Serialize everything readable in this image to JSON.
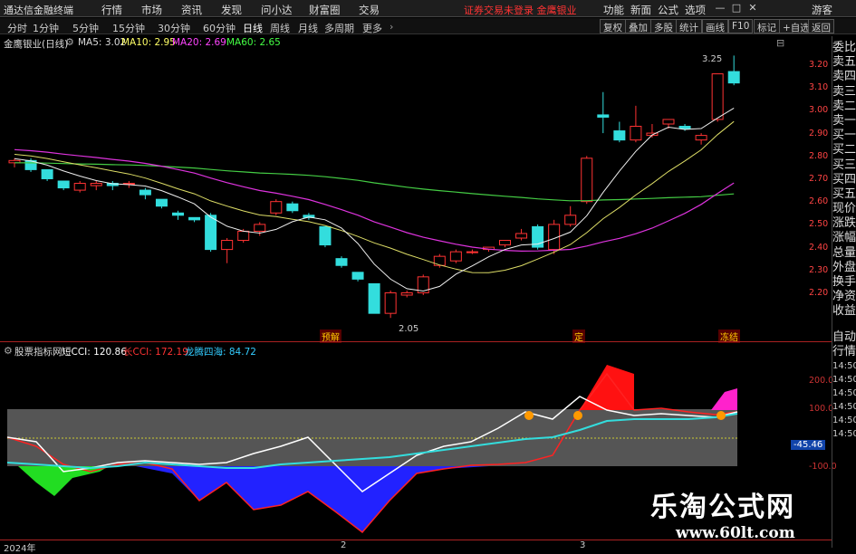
{
  "app": {
    "title": "通达信金融终端",
    "menus": [
      "行情",
      "市场",
      "资讯",
      "发现",
      "问小达",
      "财富圈",
      "交易"
    ],
    "notice": "证券交易未登录 金鹰银业",
    "top_right": [
      "功能",
      "新面",
      "公式",
      "选项"
    ],
    "window_btns": [
      "—",
      "□",
      "✕"
    ]
  },
  "toolbar": {
    "timeframes": [
      "分时",
      "1分钟",
      "5分钟",
      "15分钟",
      "30分钟",
      "60分钟",
      "日线",
      "周线",
      "月线",
      "多周期",
      "更多"
    ],
    "active": "日线",
    "right_buttons": [
      "复权",
      "叠加",
      "多股",
      "统计",
      "画线",
      "F10",
      "标记",
      "+自选",
      "返回"
    ],
    "guest": "游客"
  },
  "main_chart": {
    "title": "金鹰银业(日线)",
    "ma": [
      {
        "label": "MA5:",
        "value": "3.02",
        "color": "#dddddd"
      },
      {
        "label": "MA10:",
        "value": "2.95",
        "color": "#ffff66"
      },
      {
        "label": "MA20:",
        "value": "2.69",
        "color": "#ff44ff"
      },
      {
        "label": "MA60:",
        "value": "2.65",
        "color": "#44ff44"
      }
    ],
    "yaxis": [
      "3.20",
      "3.10",
      "3.00",
      "2.90",
      "2.80",
      "2.70",
      "2.60",
      "2.50",
      "2.40",
      "2.30",
      "2.20"
    ],
    "high_label": "3.25",
    "low_label": "2.05",
    "events": [
      "预解",
      "定",
      "冻结"
    ]
  },
  "sub_chart": {
    "title": "股票指标网",
    "indicators": [
      {
        "label": "短CCI: 120.86",
        "color": "#ffffff"
      },
      {
        "label": "长CCI: 172.19",
        "color": "#ff3333"
      },
      {
        "label": "龙腾四海: 84.72",
        "color": "#33ccff"
      }
    ],
    "yaxis": [
      "200.0",
      "100.0",
      "-100.0"
    ],
    "current": "-45.46"
  },
  "side_panel": [
    "委比",
    "卖五",
    "卖四",
    "卖三",
    "卖二",
    "卖一",
    "买一",
    "买二",
    "买三",
    "买四",
    "买五",
    "现价",
    "涨跌",
    "涨幅",
    "总量",
    "外盘",
    "换手",
    "净资",
    "收益",
    "自动",
    "行情"
  ],
  "side_times": [
    "14:50",
    "14:50",
    "14:50",
    "14:50",
    "14:50",
    "14:50"
  ],
  "dates": [
    "2024年",
    "2",
    "3"
  ],
  "watermark": {
    "line1": "乐淘公式网",
    "line2": "www.60lt.com"
  },
  "chart_data": {
    "type": "candlestick",
    "ohlc_note": "approximate daily candles",
    "candles": [
      [
        2.78,
        2.8,
        2.76,
        2.79
      ],
      [
        2.79,
        2.8,
        2.74,
        2.75
      ],
      [
        2.75,
        2.75,
        2.7,
        2.71
      ],
      [
        2.7,
        2.7,
        2.66,
        2.67
      ],
      [
        2.66,
        2.7,
        2.65,
        2.69
      ],
      [
        2.68,
        2.7,
        2.66,
        2.69
      ],
      [
        2.69,
        2.7,
        2.66,
        2.68
      ],
      [
        2.69,
        2.7,
        2.67,
        2.69
      ],
      [
        2.66,
        2.67,
        2.62,
        2.64
      ],
      [
        2.62,
        2.62,
        2.58,
        2.59
      ],
      [
        2.56,
        2.57,
        2.53,
        2.55
      ],
      [
        2.54,
        2.54,
        2.52,
        2.53
      ],
      [
        2.55,
        2.56,
        2.39,
        2.4
      ],
      [
        2.4,
        2.45,
        2.34,
        2.44
      ],
      [
        2.44,
        2.49,
        2.43,
        2.48
      ],
      [
        2.48,
        2.52,
        2.46,
        2.51
      ],
      [
        2.56,
        2.62,
        2.55,
        2.61
      ],
      [
        2.6,
        2.61,
        2.56,
        2.57
      ],
      [
        2.55,
        2.56,
        2.53,
        2.54
      ],
      [
        2.5,
        2.5,
        2.41,
        2.42
      ],
      [
        2.36,
        2.37,
        2.32,
        2.33
      ],
      [
        2.3,
        2.3,
        2.26,
        2.27
      ],
      [
        2.25,
        2.25,
        2.13,
        2.12
      ],
      [
        2.12,
        2.22,
        2.1,
        2.21
      ],
      [
        2.2,
        2.22,
        2.19,
        2.21
      ],
      [
        2.21,
        2.29,
        2.2,
        2.28
      ],
      [
        2.33,
        2.38,
        2.32,
        2.37
      ],
      [
        2.35,
        2.4,
        2.34,
        2.39
      ],
      [
        2.39,
        2.4,
        2.38,
        2.39
      ],
      [
        2.4,
        2.41,
        2.39,
        2.41
      ],
      [
        2.42,
        2.44,
        2.41,
        2.44
      ],
      [
        2.45,
        2.49,
        2.44,
        2.47
      ],
      [
        2.5,
        2.51,
        2.4,
        2.41
      ],
      [
        2.4,
        2.53,
        2.38,
        2.51
      ],
      [
        2.51,
        2.59,
        2.5,
        2.55
      ],
      [
        2.61,
        2.81,
        2.6,
        2.8
      ],
      [
        2.99,
        3.09,
        2.91,
        2.98
      ],
      [
        2.92,
        2.96,
        2.87,
        2.88
      ],
      [
        2.88,
        3.03,
        2.87,
        2.94
      ],
      [
        2.9,
        2.95,
        2.89,
        2.91
      ],
      [
        2.95,
        2.97,
        2.93,
        2.97
      ],
      [
        2.94,
        2.95,
        2.92,
        2.93
      ],
      [
        2.88,
        2.91,
        2.86,
        2.9
      ],
      [
        2.97,
        3.17,
        2.96,
        3.17
      ],
      [
        3.18,
        3.25,
        3.12,
        3.13
      ]
    ]
  }
}
